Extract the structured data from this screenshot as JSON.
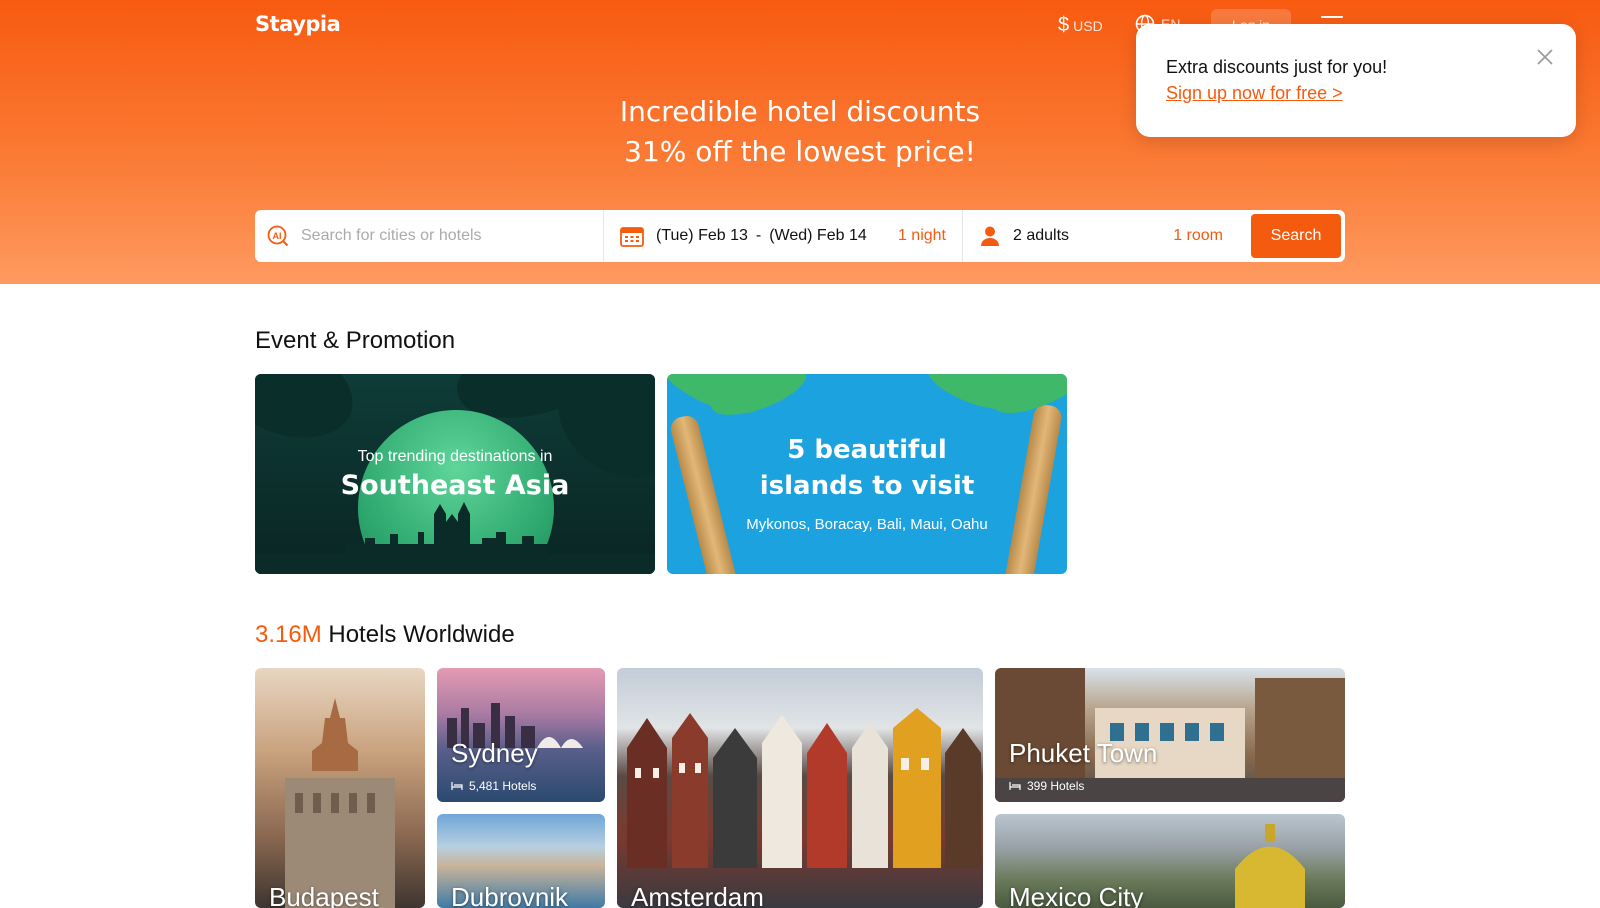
{
  "header": {
    "logo": "Staypia",
    "currency_symbol": "$",
    "currency": "USD",
    "language": "EN",
    "login_label": "Log in"
  },
  "hero": {
    "line1": "Incredible hotel discounts",
    "line2": "31% off the lowest price!"
  },
  "search": {
    "placeholder": "Search for cities or hotels",
    "checkin": "(Tue) Feb 13",
    "separator": "-",
    "checkout": "(Wed) Feb 14",
    "nights": "1 night",
    "guests": "2 adults",
    "rooms": "1 room",
    "button_label": "Search"
  },
  "popup": {
    "title": "Extra discounts just for you!",
    "link": "Sign up now for free >"
  },
  "promotions": {
    "heading": "Event & Promotion",
    "cards": [
      {
        "line1": "Top trending destinations in",
        "line2": "Southeast Asia"
      },
      {
        "line1": "5 beautiful islands to visit",
        "line2": "Mykonos, Boracay, Bali, Maui, Oahu"
      }
    ]
  },
  "hotels": {
    "count": "3.16M",
    "heading": "Hotels Worldwide",
    "cities": [
      {
        "name": "Budapest"
      },
      {
        "name": "Sydney",
        "hotels": "5,481 Hotels"
      },
      {
        "name": "Dubrovnik"
      },
      {
        "name": "Amsterdam"
      },
      {
        "name": "Phuket Town",
        "hotels": "399 Hotels"
      },
      {
        "name": "Mexico City"
      }
    ]
  },
  "colors": {
    "accent": "#f55b0f"
  }
}
